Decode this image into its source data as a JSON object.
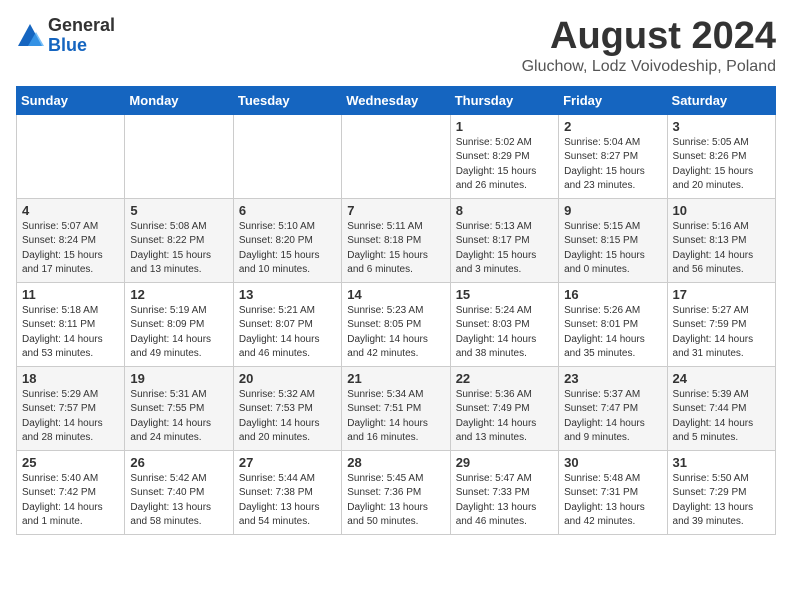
{
  "header": {
    "logo_general": "General",
    "logo_blue": "Blue",
    "month": "August 2024",
    "location": "Gluchow, Lodz Voivodeship, Poland"
  },
  "days_of_week": [
    "Sunday",
    "Monday",
    "Tuesday",
    "Wednesday",
    "Thursday",
    "Friday",
    "Saturday"
  ],
  "weeks": [
    [
      {
        "day": "",
        "info": ""
      },
      {
        "day": "",
        "info": ""
      },
      {
        "day": "",
        "info": ""
      },
      {
        "day": "",
        "info": ""
      },
      {
        "day": "1",
        "info": "Sunrise: 5:02 AM\nSunset: 8:29 PM\nDaylight: 15 hours\nand 26 minutes."
      },
      {
        "day": "2",
        "info": "Sunrise: 5:04 AM\nSunset: 8:27 PM\nDaylight: 15 hours\nand 23 minutes."
      },
      {
        "day": "3",
        "info": "Sunrise: 5:05 AM\nSunset: 8:26 PM\nDaylight: 15 hours\nand 20 minutes."
      }
    ],
    [
      {
        "day": "4",
        "info": "Sunrise: 5:07 AM\nSunset: 8:24 PM\nDaylight: 15 hours\nand 17 minutes."
      },
      {
        "day": "5",
        "info": "Sunrise: 5:08 AM\nSunset: 8:22 PM\nDaylight: 15 hours\nand 13 minutes."
      },
      {
        "day": "6",
        "info": "Sunrise: 5:10 AM\nSunset: 8:20 PM\nDaylight: 15 hours\nand 10 minutes."
      },
      {
        "day": "7",
        "info": "Sunrise: 5:11 AM\nSunset: 8:18 PM\nDaylight: 15 hours\nand 6 minutes."
      },
      {
        "day": "8",
        "info": "Sunrise: 5:13 AM\nSunset: 8:17 PM\nDaylight: 15 hours\nand 3 minutes."
      },
      {
        "day": "9",
        "info": "Sunrise: 5:15 AM\nSunset: 8:15 PM\nDaylight: 15 hours\nand 0 minutes."
      },
      {
        "day": "10",
        "info": "Sunrise: 5:16 AM\nSunset: 8:13 PM\nDaylight: 14 hours\nand 56 minutes."
      }
    ],
    [
      {
        "day": "11",
        "info": "Sunrise: 5:18 AM\nSunset: 8:11 PM\nDaylight: 14 hours\nand 53 minutes."
      },
      {
        "day": "12",
        "info": "Sunrise: 5:19 AM\nSunset: 8:09 PM\nDaylight: 14 hours\nand 49 minutes."
      },
      {
        "day": "13",
        "info": "Sunrise: 5:21 AM\nSunset: 8:07 PM\nDaylight: 14 hours\nand 46 minutes."
      },
      {
        "day": "14",
        "info": "Sunrise: 5:23 AM\nSunset: 8:05 PM\nDaylight: 14 hours\nand 42 minutes."
      },
      {
        "day": "15",
        "info": "Sunrise: 5:24 AM\nSunset: 8:03 PM\nDaylight: 14 hours\nand 38 minutes."
      },
      {
        "day": "16",
        "info": "Sunrise: 5:26 AM\nSunset: 8:01 PM\nDaylight: 14 hours\nand 35 minutes."
      },
      {
        "day": "17",
        "info": "Sunrise: 5:27 AM\nSunset: 7:59 PM\nDaylight: 14 hours\nand 31 minutes."
      }
    ],
    [
      {
        "day": "18",
        "info": "Sunrise: 5:29 AM\nSunset: 7:57 PM\nDaylight: 14 hours\nand 28 minutes."
      },
      {
        "day": "19",
        "info": "Sunrise: 5:31 AM\nSunset: 7:55 PM\nDaylight: 14 hours\nand 24 minutes."
      },
      {
        "day": "20",
        "info": "Sunrise: 5:32 AM\nSunset: 7:53 PM\nDaylight: 14 hours\nand 20 minutes."
      },
      {
        "day": "21",
        "info": "Sunrise: 5:34 AM\nSunset: 7:51 PM\nDaylight: 14 hours\nand 16 minutes."
      },
      {
        "day": "22",
        "info": "Sunrise: 5:36 AM\nSunset: 7:49 PM\nDaylight: 14 hours\nand 13 minutes."
      },
      {
        "day": "23",
        "info": "Sunrise: 5:37 AM\nSunset: 7:47 PM\nDaylight: 14 hours\nand 9 minutes."
      },
      {
        "day": "24",
        "info": "Sunrise: 5:39 AM\nSunset: 7:44 PM\nDaylight: 14 hours\nand 5 minutes."
      }
    ],
    [
      {
        "day": "25",
        "info": "Sunrise: 5:40 AM\nSunset: 7:42 PM\nDaylight: 14 hours\nand 1 minute."
      },
      {
        "day": "26",
        "info": "Sunrise: 5:42 AM\nSunset: 7:40 PM\nDaylight: 13 hours\nand 58 minutes."
      },
      {
        "day": "27",
        "info": "Sunrise: 5:44 AM\nSunset: 7:38 PM\nDaylight: 13 hours\nand 54 minutes."
      },
      {
        "day": "28",
        "info": "Sunrise: 5:45 AM\nSunset: 7:36 PM\nDaylight: 13 hours\nand 50 minutes."
      },
      {
        "day": "29",
        "info": "Sunrise: 5:47 AM\nSunset: 7:33 PM\nDaylight: 13 hours\nand 46 minutes."
      },
      {
        "day": "30",
        "info": "Sunrise: 5:48 AM\nSunset: 7:31 PM\nDaylight: 13 hours\nand 42 minutes."
      },
      {
        "day": "31",
        "info": "Sunrise: 5:50 AM\nSunset: 7:29 PM\nDaylight: 13 hours\nand 39 minutes."
      }
    ]
  ]
}
